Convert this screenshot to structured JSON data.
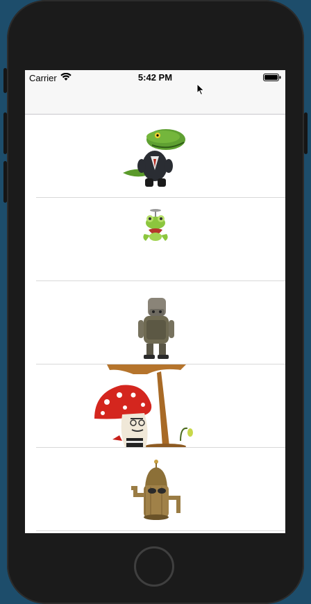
{
  "status_bar": {
    "carrier": "Carrier",
    "time": "5:42 PM",
    "wifi_icon": "wifi-icon",
    "battery_icon": "battery-icon"
  },
  "table": {
    "rows": [
      {
        "image": "crocodile-in-suit-character"
      },
      {
        "image": "frog-with-propeller-character"
      },
      {
        "image": "rusty-robot-character"
      },
      {
        "image": "mushroom-character-with-lamp"
      },
      {
        "image": "wooden-pipe-robot-character"
      }
    ]
  },
  "colors": {
    "background": "#1d4d6b",
    "device": "#1b1b1b",
    "nav_bar": "#f7f7f7",
    "separator": "#d8d8d8"
  }
}
